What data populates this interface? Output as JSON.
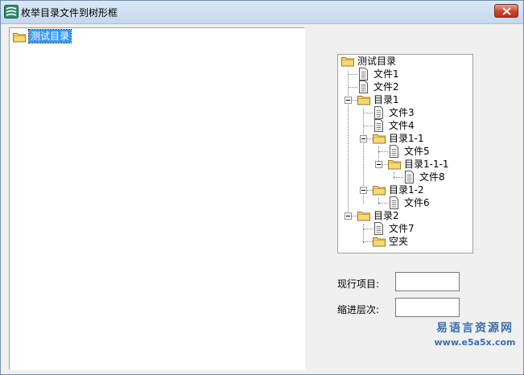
{
  "window": {
    "title": "枚举目录文件到树形框"
  },
  "left_tree": {
    "root_label": "测试目录"
  },
  "right_tree": {
    "root": "测试目录",
    "nodes": [
      {
        "label": "文件1",
        "type": "file"
      },
      {
        "label": "文件2",
        "type": "file"
      },
      {
        "label": "目录1",
        "type": "folder"
      },
      {
        "label": "文件3",
        "type": "file"
      },
      {
        "label": "文件4",
        "type": "file"
      },
      {
        "label": "目录1-1",
        "type": "folder"
      },
      {
        "label": "文件5",
        "type": "file"
      },
      {
        "label": "目录1-1-1",
        "type": "folder"
      },
      {
        "label": "文件8",
        "type": "file"
      },
      {
        "label": "目录1-2",
        "type": "folder"
      },
      {
        "label": "文件6",
        "type": "file"
      },
      {
        "label": "目录2",
        "type": "folder"
      },
      {
        "label": "文件7",
        "type": "file"
      },
      {
        "label": "空夹",
        "type": "folder"
      }
    ]
  },
  "fields": {
    "current_item_label": "现行项目:",
    "current_item_value": "",
    "indent_level_label": "缩进层次:",
    "indent_level_value": ""
  },
  "watermark": {
    "line1": "易语言资源网",
    "line2": "www.e5a5x.com"
  },
  "icons": {
    "folder": "folder-icon",
    "file": "file-icon",
    "close": "close-icon",
    "app": "app-icon"
  },
  "colors": {
    "selection": "#3399ff",
    "folder": "#f6d874",
    "close_button": "#c9452f"
  }
}
